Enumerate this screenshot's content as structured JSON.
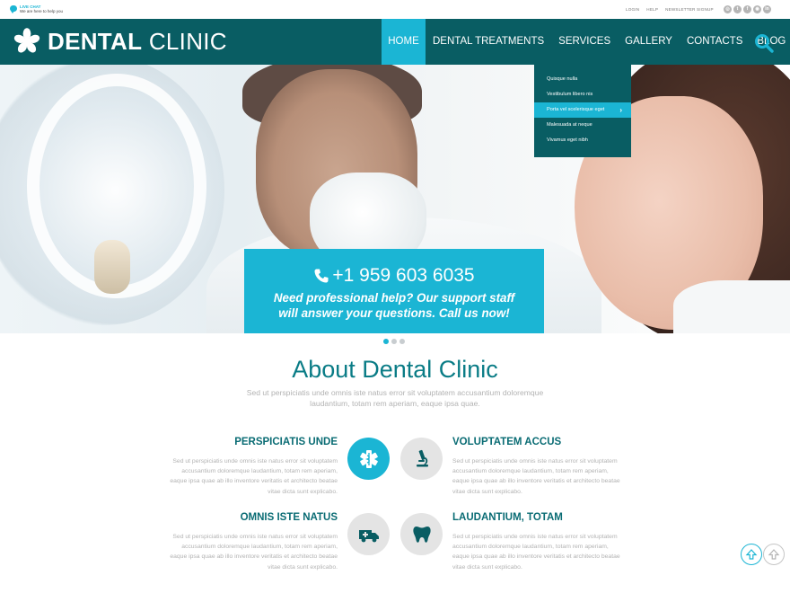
{
  "topbar": {
    "livechat_title": "LIVE CHAT",
    "livechat_sub": "We are here to help you",
    "links": [
      "LOGIN",
      "HELP",
      "NEWSLETTER SIGNUP"
    ],
    "social_icons": [
      "instagram-icon",
      "twitter-icon",
      "facebook-icon",
      "dribbble-icon",
      "linkedin-icon"
    ]
  },
  "header": {
    "brand_bold": "DENTAL",
    "brand_light": "CLINIC",
    "nav": [
      "HOME",
      "DENTAL TREATMENTS",
      "SERVICES",
      "GALLERY",
      "CONTACTS",
      "BLOG"
    ],
    "active_nav": "HOME"
  },
  "dropdown": {
    "items": [
      "Quisque nulla",
      "Vestibulum libero nis",
      "Porta vel scelerisque eget",
      "Malesuada at neque",
      "Vivamus eget nibh"
    ],
    "active": "Porta vel scelerisque eget"
  },
  "hero": {
    "phone": "+1 959 603 6035",
    "message": "Need professional help? Our support staff will answer your questions. Call us now!",
    "slides": 3,
    "current_slide": 1
  },
  "about": {
    "title": "About Dental Clinic",
    "subtitle": "Sed ut perspiciatis unde omnis iste natus error sit voluptatem accusantium doloremque laudantium, totam rem aperiam, eaque ipsa quae.",
    "features": [
      {
        "title": "PERSPICIATIS UNDE",
        "icon": "medical-cross-icon",
        "text": "Sed ut perspiciatis unde omnis iste natus error sit voluptatem accusantium doloremque laudantium, totam rem aperiam, eaque ipsa quae ab illo inventore veritatis et  architecto beatae vitae dicta sunt explicabo."
      },
      {
        "title": "VOLUPTATEM ACCUS",
        "icon": "microscope-icon",
        "text": "Sed ut perspiciatis unde omnis iste natus error sit voluptatem accusantium doloremque laudantium, totam rem aperiam, eaque ipsa quae ab illo inventore veritatis et  architecto beatae vitae dicta sunt explicabo."
      },
      {
        "title": "OMNIS ISTE NATUS",
        "icon": "ambulance-icon",
        "text": "Sed ut perspiciatis unde omnis iste natus error sit voluptatem accusantium doloremque laudantium, totam rem aperiam, eaque ipsa quae ab illo inventore veritatis et  architecto beatae vitae dicta sunt explicabo."
      },
      {
        "title": "LAUDANTIUM, TOTAM",
        "icon": "tooth-icon",
        "text": "Sed ut perspiciatis unde omnis iste natus error sit voluptatem accusantium doloremque laudantium, totam rem aperiam, eaque ipsa quae ab illo inventore veritatis et  architecto beatae vitae dicta sunt explicabo."
      }
    ]
  },
  "colors": {
    "header_bg": "#095d63",
    "accent": "#1bb5d4",
    "title": "#0a7c86"
  }
}
